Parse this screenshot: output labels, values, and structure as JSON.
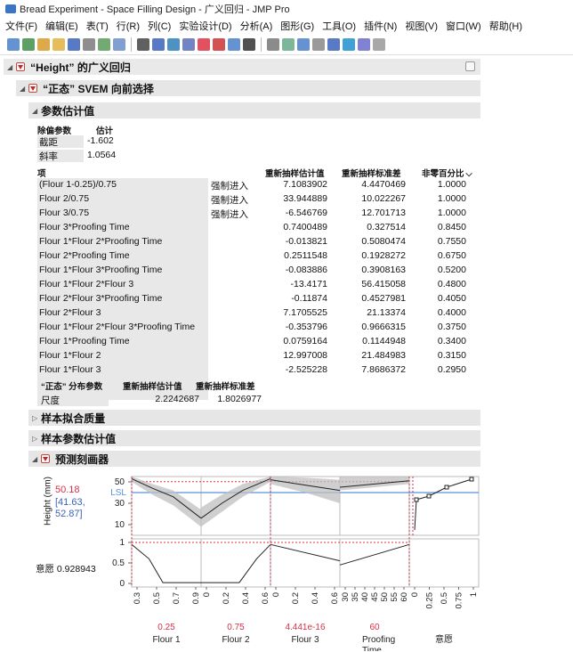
{
  "window": {
    "title": "Bread Experiment - Space Filling Design - 广义回归 - JMP Pro"
  },
  "menu": [
    "文件(F)",
    "编辑(E)",
    "表(T)",
    "行(R)",
    "列(C)",
    "实验设计(D)",
    "分析(A)",
    "图形(G)",
    "工具(O)",
    "插件(N)",
    "视图(V)",
    "窗口(W)",
    "帮助(H)"
  ],
  "toolbar_icons": [
    "new-table-icon",
    "new-script-icon",
    "open-data-icon",
    "open-folder-icon",
    "save-icon",
    "copy-icon",
    "paste-icon",
    "table-view-icon",
    "search-icon",
    "distribution-icon",
    "fit-y-x-icon",
    "fit-model-icon",
    "graph-builder-icon",
    "control-chart-icon",
    "variability-icon",
    "sort-icon",
    "text-icon",
    "image-icon",
    "table-icon",
    "data-view-icon",
    "report-icon",
    "columns-icon",
    "split-icon",
    "stack-icon"
  ],
  "report": {
    "title": "“Height” 的广义回归",
    "svem_title": "“正态” SVEM 向前选择",
    "param_title": "参数估计值",
    "remove_param_hdr": "除偏参数",
    "estimate_hdr": "估计",
    "intercept_label": "截距",
    "intercept_value": "-1.602",
    "slope_label": "斜率",
    "slope_value": "1.0564",
    "term_hdr": "项",
    "resample_est_hdr": "重新抽样估计值",
    "resample_se_hdr": "重新抽样标准差",
    "nonzero_hdr": "非零百分比",
    "sort_icon": "chevron-down-icon",
    "terms": [
      {
        "term": "(Flour 1-0.25)/0.75",
        "forced": "强制进入",
        "est": "7.1083902",
        "se": "4.4470469",
        "pct": "1.0000"
      },
      {
        "term": "Flour 2/0.75",
        "forced": "强制进入",
        "est": "33.944889",
        "se": "10.022267",
        "pct": "1.0000"
      },
      {
        "term": "Flour 3/0.75",
        "forced": "强制进入",
        "est": "-6.546769",
        "se": "12.701713",
        "pct": "1.0000"
      },
      {
        "term": "Flour 3*Proofing Time",
        "forced": "",
        "est": "0.7400489",
        "se": "0.327514",
        "pct": "0.8450"
      },
      {
        "term": "Flour 1*Flour 2*Proofing Time",
        "forced": "",
        "est": "-0.013821",
        "se": "0.5080474",
        "pct": "0.7550"
      },
      {
        "term": "Flour 2*Proofing Time",
        "forced": "",
        "est": "0.2511548",
        "se": "0.1928272",
        "pct": "0.6750"
      },
      {
        "term": "Flour 1*Flour 3*Proofing Time",
        "forced": "",
        "est": "-0.083886",
        "se": "0.3908163",
        "pct": "0.5200"
      },
      {
        "term": "Flour 1*Flour 2*Flour 3",
        "forced": "",
        "est": "-13.4171",
        "se": "56.415058",
        "pct": "0.4800"
      },
      {
        "term": "Flour 2*Flour 3*Proofing Time",
        "forced": "",
        "est": "-0.11874",
        "se": "0.4527981",
        "pct": "0.4050"
      },
      {
        "term": "Flour 2*Flour 3",
        "forced": "",
        "est": "7.1705525",
        "se": "21.13374",
        "pct": "0.4000"
      },
      {
        "term": "Flour 1*Flour 2*Flour 3*Proofing Time",
        "forced": "",
        "est": "-0.353796",
        "se": "0.9666315",
        "pct": "0.3750"
      },
      {
        "term": "Flour 1*Proofing Time",
        "forced": "",
        "est": "0.0759164",
        "se": "0.1144948",
        "pct": "0.3400"
      },
      {
        "term": "Flour 1*Flour 2",
        "forced": "",
        "est": "12.997008",
        "se": "21.484983",
        "pct": "0.3150"
      },
      {
        "term": "Flour 1*Flour 3",
        "forced": "",
        "est": "-2.525228",
        "se": "7.8686372",
        "pct": "0.2950"
      }
    ],
    "dist_param_hdr": "“正态” 分布参数",
    "dist_est_hdr": "重新抽样估计值",
    "dist_se_hdr": "重新抽样标准差",
    "scale_label": "尺度",
    "scale_est": "2.2242687",
    "scale_se": "1.8026977",
    "fit_quality": "样本拟合质量",
    "sample_param": "样本参数估计值",
    "profiler_title": "预测刻画器"
  },
  "profiler": {
    "y1_label": "Height (mm)",
    "y1_value": "50.18",
    "y1_ci": "[41.63,",
    "y1_ci2": "52.87]",
    "lsl_label": "LSL",
    "y1_ticks": [
      "50",
      "30",
      "10"
    ],
    "y2_label": "意愿",
    "y2_value": "0.928943",
    "y2_ticks": [
      "1",
      "0.5",
      "0"
    ],
    "factors": [
      {
        "name": "Flour 1",
        "value": "0.25",
        "ticks": [
          "0.3",
          "0.5",
          "0.7",
          "0.9"
        ]
      },
      {
        "name": "Flour 2",
        "value": "0.75",
        "ticks": [
          "0",
          "0.2",
          "0.4",
          "0.6"
        ]
      },
      {
        "name": "Flour 3",
        "value": "4.441e-16",
        "ticks": [
          "0",
          "0.2",
          "0.4",
          "0.6"
        ]
      },
      {
        "name": "Proofing Time",
        "value": "60",
        "ticks": [
          "30",
          "35",
          "40",
          "45",
          "50",
          "55",
          "60"
        ]
      },
      {
        "name": "意愿",
        "value": "",
        "ticks": [
          "0",
          "0.25",
          "0.5",
          "0.75",
          "1"
        ]
      }
    ],
    "colors": {
      "red": "#d8304a",
      "blue": "#3b62b8",
      "lsl": "#5a8fe0",
      "band": "#bfbfbf"
    }
  }
}
